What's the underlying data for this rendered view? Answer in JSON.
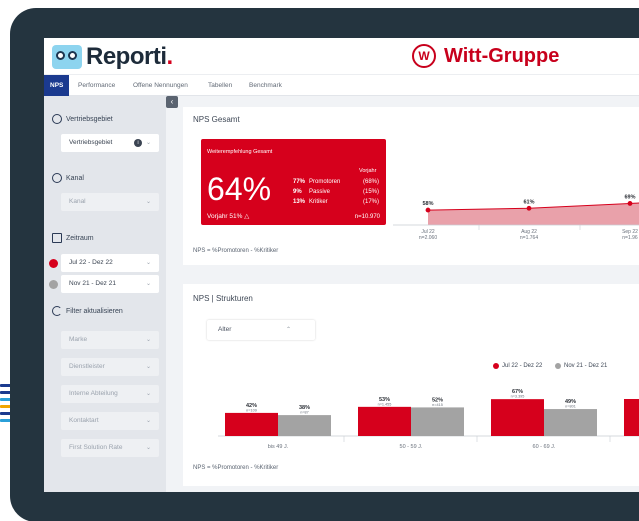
{
  "app": {
    "logo_text": "Reporti",
    "logo_dot": ".",
    "brand_mark": "W",
    "brand_name": "Witt-Gruppe"
  },
  "nav": {
    "items": [
      "NPS",
      "Performance",
      "Offene Nennungen",
      "Tabellen",
      "Benchmark"
    ],
    "active": "NPS"
  },
  "sidebar": {
    "collapse_glyph": "‹",
    "vertriebsgebiet_label": "Vertriebsgebiet",
    "vertriebsgebiet_value": "Vertriebsgebiet",
    "kanal_label": "Kanal",
    "kanal_placeholder": "Kanal",
    "zeitraum_label": "Zeitraum",
    "period_current": "Jul 22 - Dez 22",
    "period_previous": "Nov 21 - Dez 21",
    "filter_label": "Filter aktualisieren",
    "filters": [
      "Marke",
      "Dienstleister",
      "Interne Abteilung",
      "Kontaktart",
      "First Solution Rate"
    ],
    "chevron": "⌄",
    "info_glyph": "i"
  },
  "nps_card": {
    "title": "NPS Gesamt",
    "kpi_title": "Weiterempfehlung Gesamt",
    "score": "64%",
    "vorjahr_label": "Vorjahr",
    "rows": [
      {
        "pct": "77%",
        "label": "Promotoren",
        "prev": "(68%)"
      },
      {
        "pct": "9%",
        "label": "Passive",
        "prev": "(15%)"
      },
      {
        "pct": "13%",
        "label": "Kritiker",
        "prev": "(17%)"
      }
    ],
    "prev_year_text": "Vorjahr 51% △",
    "n_text": "n=10.970",
    "footnote": "NPS = %Promotoren - %Kritiker"
  },
  "struct_card": {
    "title": "NPS | Strukturen",
    "select_value": "Alter",
    "select_chevron": "⌃",
    "legend": [
      {
        "label": "Jul 22 - Dez 22",
        "color": "#d6001c"
      },
      {
        "label": "Nov 21 - Dez 21",
        "color": "#a3a3a3"
      }
    ],
    "footnote": "NPS = %Promotoren - %Kritiker"
  },
  "colors": {
    "accent": "#d6001c",
    "nav_active": "#1b3a8f",
    "grey_series": "#a3a3a3",
    "device": "#24343f"
  },
  "chart_data": [
    {
      "type": "area",
      "title": "",
      "xlabel": "",
      "ylabel": "",
      "categories": [
        "Jul 22",
        "Aug 22",
        "Sep 22"
      ],
      "sample_sizes": [
        "n=2.060",
        "n=1.764",
        "n=1.96"
      ],
      "series": [
        {
          "values": [
            58,
            61,
            69
          ],
          "labels": [
            "58%",
            "61%",
            "69%"
          ]
        }
      ]
    },
    {
      "type": "bar",
      "title": "",
      "xlabel": "",
      "ylabel": "",
      "categories": [
        "bis 49 J.",
        "50 - 59 J.",
        "60 - 69 J."
      ],
      "series": [
        {
          "name": "Jul 22 - Dez 22",
          "values": [
            42,
            53,
            67
          ],
          "labels": [
            "42%",
            "53%",
            "67%"
          ],
          "n": [
            "n=109",
            "n=1.455",
            "n=3.395"
          ]
        },
        {
          "name": "Nov 21 - Dez 21",
          "values": [
            38,
            52,
            49
          ],
          "labels": [
            "38%",
            "52%",
            "49%"
          ],
          "n": [
            "n=87",
            "n=415",
            "n=801"
          ]
        }
      ]
    }
  ]
}
